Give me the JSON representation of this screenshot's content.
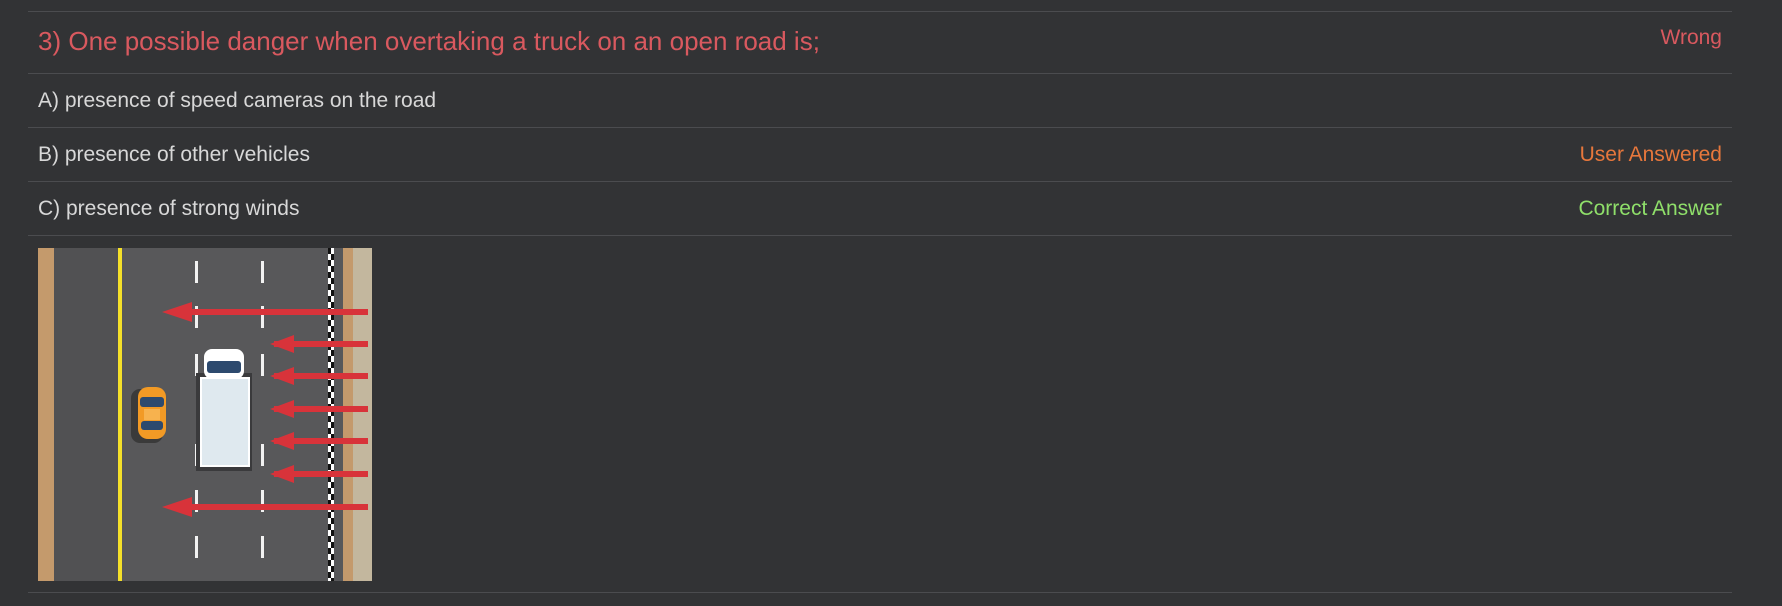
{
  "question": {
    "number_text": "3) One possible danger when overtaking a truck on an open road is;",
    "status": "Wrong"
  },
  "answers": [
    {
      "label": "A) presence of speed cameras on the road",
      "tag": ""
    },
    {
      "label": "B) presence of other vehicles",
      "tag": "User Answered"
    },
    {
      "label": "C) presence of strong winds",
      "tag": "Correct Answer"
    }
  ],
  "colors": {
    "wrong": "#d9595f",
    "user_answered": "#e7773c",
    "correct": "#8fdf6a",
    "background": "#323335",
    "wind_arrow": "#d8333a"
  }
}
